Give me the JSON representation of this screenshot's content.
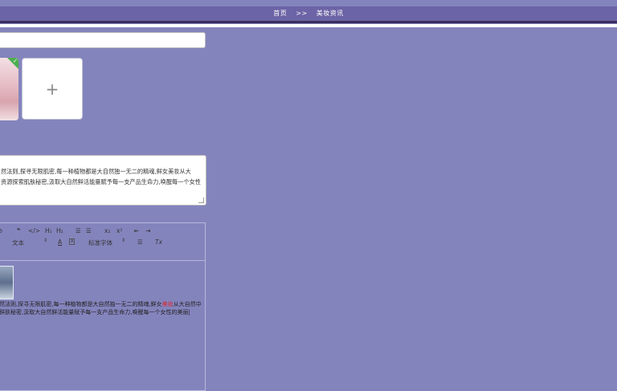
{
  "breadcrumb": {
    "home": "首页",
    "separator": ">>",
    "current": "美妆资讯"
  },
  "summary": {
    "line1": "然法则,探寻无限肌密,每一种植物都是大自然独一无二的精魂,鲜女美妆从大",
    "line2": "资源探索肌肤秘密,汲取大自然鲜活能量赋予每一支产品生命力,唤醒每一个女性"
  },
  "upload": {
    "add_symbol": "+"
  },
  "toolbar": {
    "quote": "❞",
    "code": "</>",
    "h1": "H₁",
    "h2": "H₂",
    "ordered_list": "☰",
    "bullet_list": "☰",
    "subscript": "x₂",
    "superscript": "x²",
    "indent": "⇤",
    "outdent": "⇥",
    "size_select": "文本",
    "font_color": "A",
    "bg_color": "A",
    "font_select": "标准字体",
    "align": "☰",
    "clean": "Tx"
  },
  "editor_content": {
    "line1_pre": "然法则,探寻无限肌密,每一种植物都是大自然独一无二的精魂,鲜女",
    "line1_red": "美妆",
    "line1_post": "从大自然中",
    "line2": "鲜肤秘密,汲取大自然鲜活能量赋予每一支产品生命力,唤醒每一个女性的美丽|"
  }
}
